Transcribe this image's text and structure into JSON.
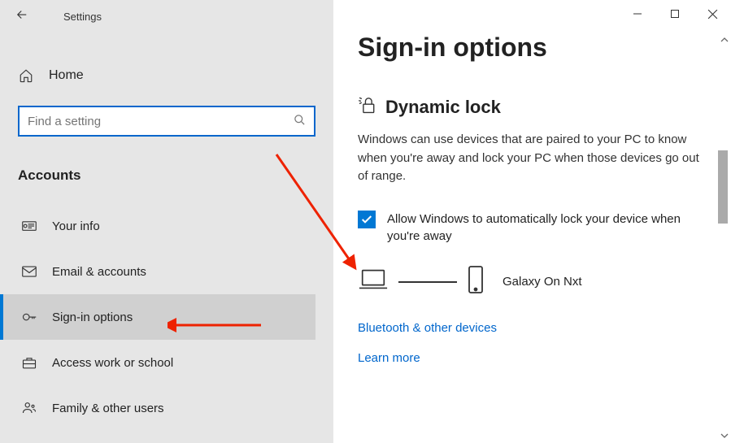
{
  "app_title": "Settings",
  "home_label": "Home",
  "search": {
    "placeholder": "Find a setting"
  },
  "category": "Accounts",
  "nav": [
    {
      "label": "Your info"
    },
    {
      "label": "Email & accounts"
    },
    {
      "label": "Sign-in options"
    },
    {
      "label": "Access work or school"
    },
    {
      "label": "Family & other users"
    }
  ],
  "page_title": "Sign-in options",
  "section": {
    "title": "Dynamic lock",
    "desc": "Windows can use devices that are paired to your PC to know when you're away and lock your PC when those devices go out of range.",
    "checkbox_label": "Allow Windows to automatically lock your device when you're away",
    "device_name": "Galaxy On Nxt",
    "link_bluetooth": "Bluetooth & other devices",
    "link_learn": "Learn more"
  }
}
